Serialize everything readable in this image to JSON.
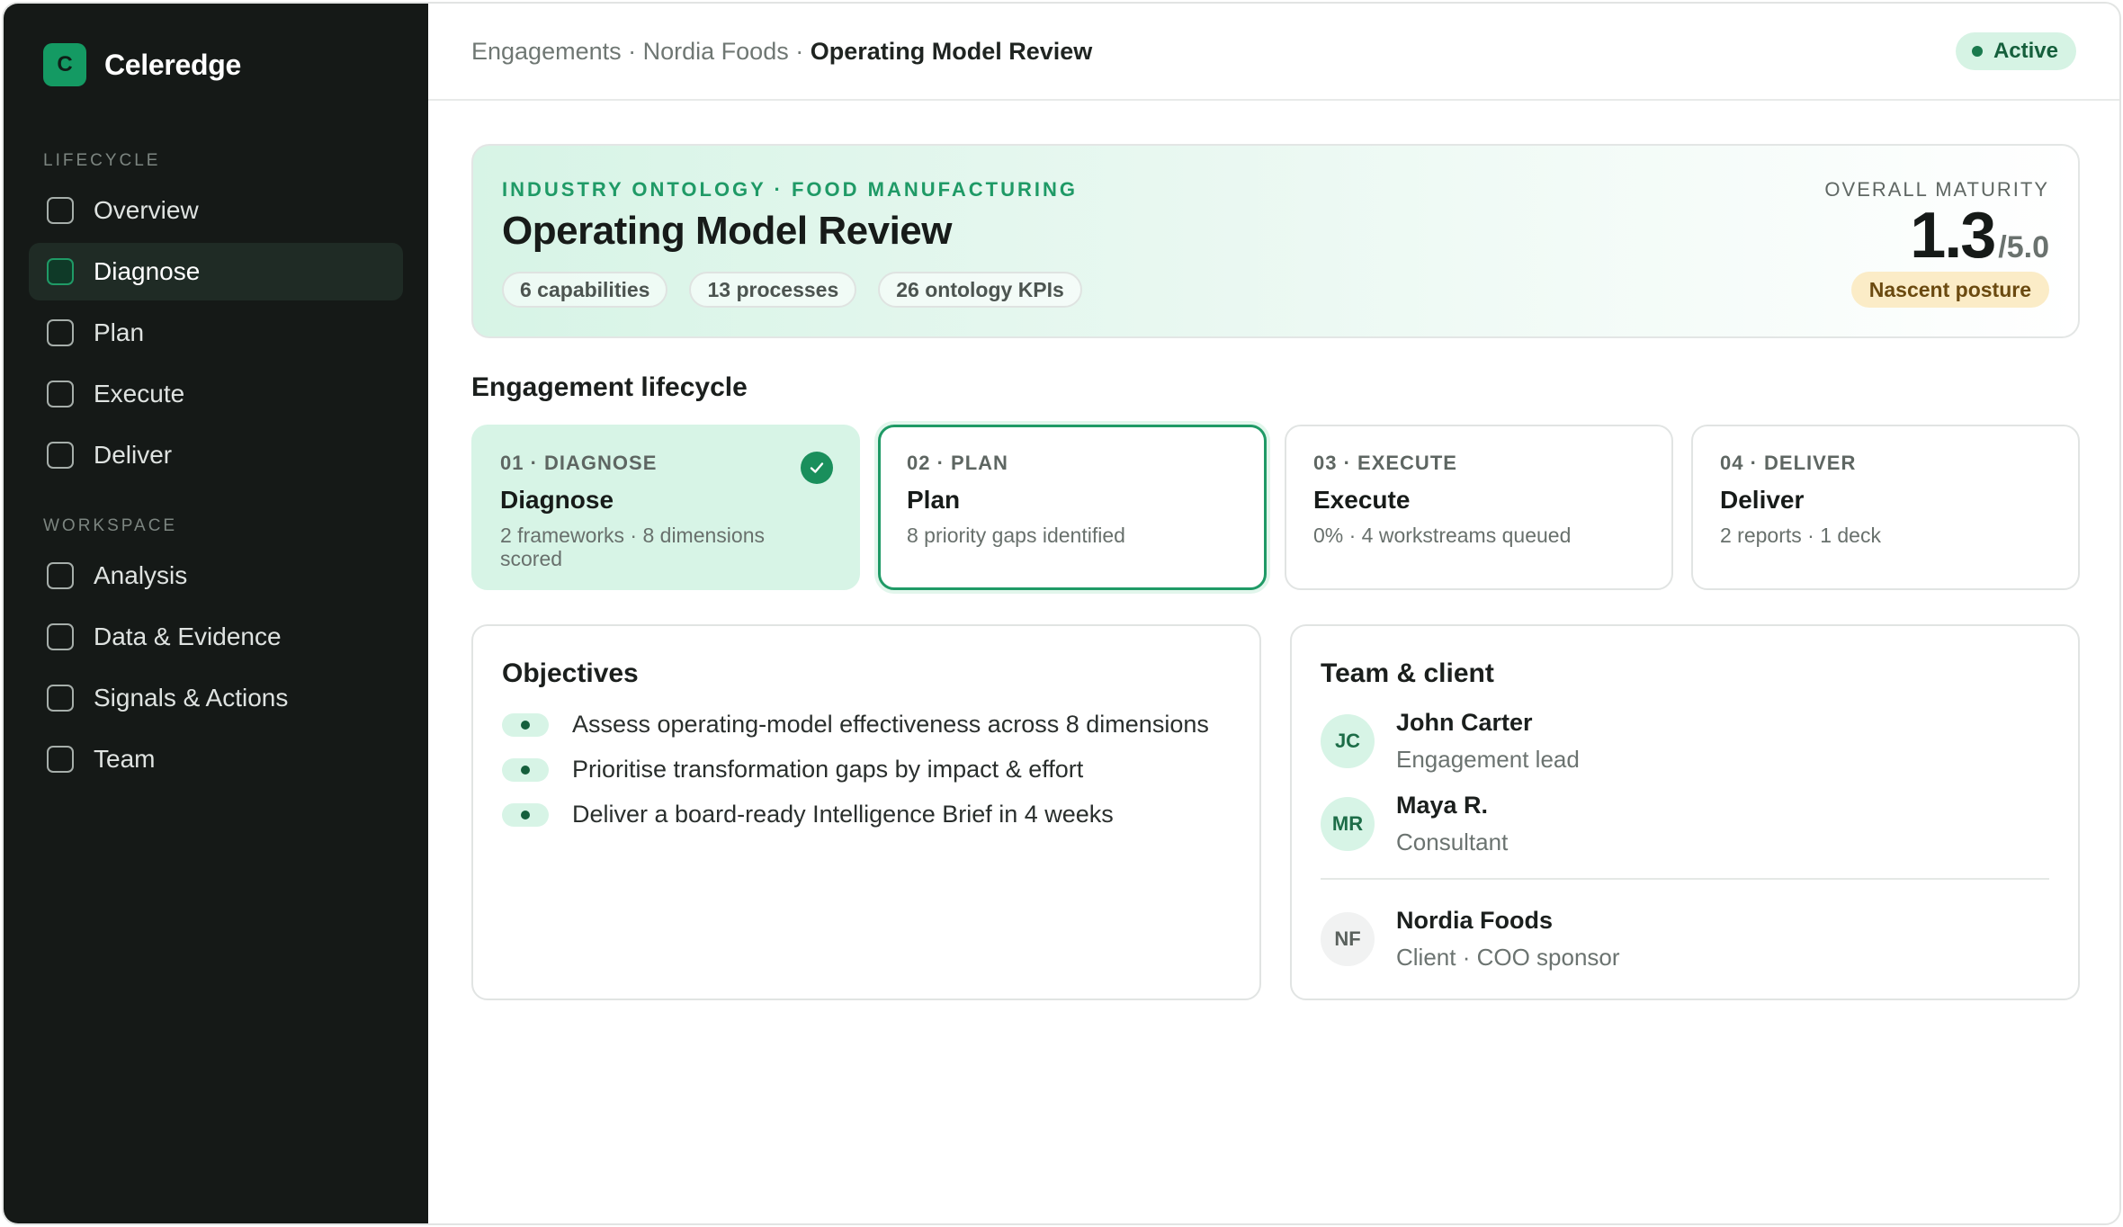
{
  "brand": {
    "logo_letter": "C",
    "name": "Celeredge"
  },
  "sidebar": {
    "sections": [
      {
        "label": "LIFECYCLE",
        "items": [
          "Overview",
          "Diagnose",
          "Plan",
          "Execute",
          "Deliver"
        ]
      },
      {
        "label": "WORKSPACE",
        "items": [
          "Analysis",
          "Data & Evidence",
          "Signals & Actions",
          "Team"
        ]
      }
    ],
    "active_item": "Diagnose"
  },
  "breadcrumb": {
    "items": [
      "Engagements",
      "Nordia Foods"
    ],
    "separator": " · ",
    "current": "Operating Model Review"
  },
  "status": {
    "label": "Active",
    "color": "#1a7a4e"
  },
  "hero": {
    "eyebrow": "INDUSTRY ONTOLOGY · FOOD MANUFACTURING",
    "title": "Operating Model Review",
    "chips": [
      "6 capabilities",
      "13 processes",
      "26 ontology KPIs"
    ],
    "maturity_label": "OVERALL MATURITY",
    "maturity_score": "1.3",
    "maturity_max": "/5.0",
    "posture": "Nascent posture"
  },
  "lifecycle": {
    "title": "Engagement lifecycle",
    "phases": [
      {
        "step": "01 · DIAGNOSE",
        "name": "Diagnose",
        "detail": "2 frameworks · 8 dimensions scored",
        "state": "done"
      },
      {
        "step": "02 · PLAN",
        "name": "Plan",
        "detail": "8 priority gaps identified",
        "state": "current"
      },
      {
        "step": "03 · EXECUTE",
        "name": "Execute",
        "detail": "0% · 4 workstreams queued",
        "state": "upcoming"
      },
      {
        "step": "04 · DELIVER",
        "name": "Deliver",
        "detail": "2 reports · 1 deck",
        "state": "upcoming"
      }
    ]
  },
  "objectives": {
    "title": "Objectives",
    "items": [
      "Assess operating-model effectiveness across 8 dimensions",
      "Prioritise transformation gaps by impact & effort",
      "Deliver a board-ready Intelligence Brief in 4 weeks"
    ]
  },
  "team": {
    "title": "Team & client",
    "members": [
      {
        "initials": "JC",
        "name": "John Carter",
        "role": "Engagement lead"
      },
      {
        "initials": "MR",
        "name": "Maya R.",
        "role": "Consultant"
      }
    ],
    "client": {
      "initials": "NF",
      "name": "Nordia Foods",
      "role": "Client · COO sponsor"
    }
  },
  "colors": {
    "accent": "#1f9a66",
    "sidebar_bg": "#151917",
    "mint": "#d7f4e6",
    "posture_bg": "#fbecc7"
  }
}
